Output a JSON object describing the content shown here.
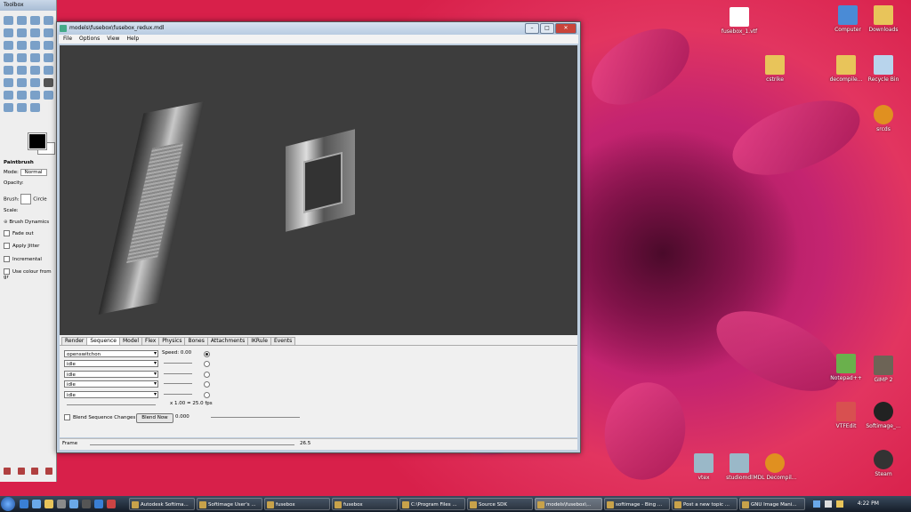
{
  "toolbox": {
    "title": "Toolbox",
    "tool_name": "Paintbrush",
    "mode_label": "Mode:",
    "mode_value": "Normal",
    "opacity_label": "Opacity:",
    "brush_label": "Brush:",
    "brush_value": "Circle",
    "scale_label": "Scale:",
    "brush_dynamics": "Brush Dynamics",
    "fade_out": "Fade out",
    "apply_jitter": "Apply Jitter",
    "incremental": "Incremental",
    "use_colour": "Use colour from gr"
  },
  "window": {
    "title": "models\\fusebox\\fusebox_redux.mdl",
    "menu": [
      "File",
      "Options",
      "View",
      "Help"
    ],
    "tabs": [
      "Render",
      "Sequence",
      "Model",
      "Flex",
      "Physics",
      "Bones",
      "Attachments",
      "IKRule",
      "Events"
    ],
    "active_tab": "Sequence",
    "sequences": [
      "openswitchon",
      "idle",
      "idle",
      "idle",
      "idle"
    ],
    "speed_label": "Speed: 0.00",
    "fps_text": "x 1.00 = 25.0 fps",
    "blend_label": "Blend Sequence Changes",
    "blend_now": "Blend Now",
    "blend_value": "0.000",
    "frame_label": "Frame",
    "frame_value": "26.5"
  },
  "desktop_icons": [
    {
      "label": "fusebox_1.vtf"
    },
    {
      "label": "Computer"
    },
    {
      "label": "Downloads"
    },
    {
      "label": "cstrike"
    },
    {
      "label": "decompile..."
    },
    {
      "label": "Recycle Bin"
    },
    {
      "label": "srcds"
    },
    {
      "label": "Notepad++"
    },
    {
      "label": "GIMP 2"
    },
    {
      "label": "VTFEdit"
    },
    {
      "label": "Softimage_..."
    },
    {
      "label": "vtex"
    },
    {
      "label": "studiomdl"
    },
    {
      "label": "MDL Decompil..."
    },
    {
      "label": "Steam"
    }
  ],
  "taskbar": {
    "buttons": [
      "Autodesk Softima...",
      "Softimage User's ...",
      "fusebox",
      "fusebox",
      "C:\\Program Files ...",
      "Source SDK",
      "models\\fusebox\\...",
      "softimage - Bing ...",
      "Post a new topic ...",
      "GNU Image Mani..."
    ],
    "active_button": "models\\fusebox\\...",
    "clock": "4:22 PM"
  }
}
